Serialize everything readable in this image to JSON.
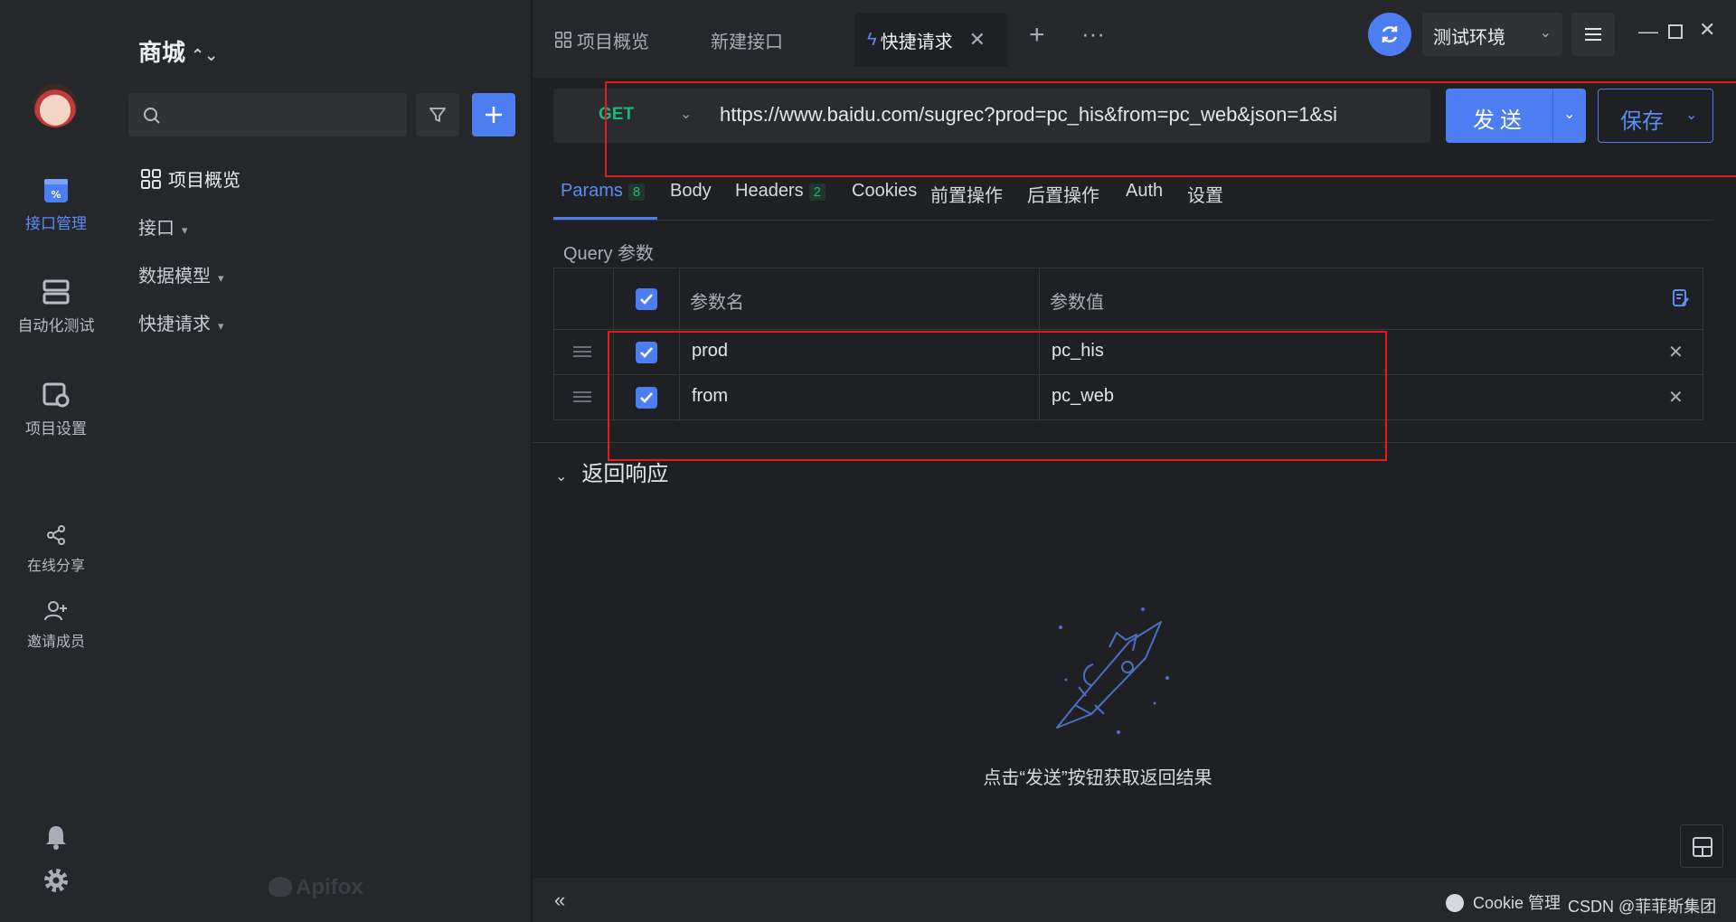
{
  "rail": {
    "items": [
      {
        "label": "接口管理",
        "icon": "api-management-icon"
      },
      {
        "label": "自动化测试",
        "icon": "automation-test-icon"
      },
      {
        "label": "项目设置",
        "icon": "project-settings-icon"
      },
      {
        "label": "在线分享",
        "icon": "share-icon"
      },
      {
        "label": "邀请成员",
        "icon": "invite-member-icon"
      }
    ],
    "bottom": [
      "bell-icon",
      "settings-icon"
    ]
  },
  "tree": {
    "project_name": "商城",
    "search_placeholder": "",
    "items": [
      {
        "label": "项目概览"
      },
      {
        "label": "接口"
      },
      {
        "label": "数据模型"
      },
      {
        "label": "快捷请求"
      }
    ],
    "brand": "Apifox"
  },
  "tabs": [
    {
      "label": "项目概览"
    },
    {
      "label": "新建接口"
    },
    {
      "label": "快捷请求"
    }
  ],
  "env": {
    "selected": "测试环境"
  },
  "request": {
    "method": "GET",
    "url": "https://www.baidu.com/sugrec?prod=pc_his&from=pc_web&json=1&si",
    "send_label": "发送",
    "save_label": "保存"
  },
  "req_tabs": [
    {
      "label": "Params",
      "count": "8"
    },
    {
      "label": "Body",
      "count": ""
    },
    {
      "label": "Headers",
      "count": "2"
    },
    {
      "label": "Cookies",
      "count": ""
    },
    {
      "label": "前置操作",
      "count": ""
    },
    {
      "label": "后置操作",
      "count": ""
    },
    {
      "label": "Auth",
      "count": ""
    },
    {
      "label": "设置",
      "count": ""
    }
  ],
  "query_label": "Query 参数",
  "params_table": {
    "headers": {
      "name": "参数名",
      "value": "参数值"
    },
    "rows": [
      {
        "name": "prod",
        "value": "pc_his",
        "enabled": true
      },
      {
        "name": "from",
        "value": "pc_web",
        "enabled": true
      }
    ]
  },
  "response": {
    "title": "返回响应",
    "empty_hint": "点击“发送”按钮获取返回结果"
  },
  "statusbar": {
    "cookie_label": "Cookie 管理",
    "watermark": "CSDN @菲菲斯集团"
  },
  "colors": {
    "accent": "#4c7ef2",
    "get": "#1fb679",
    "highlight": "#e21b1b"
  }
}
